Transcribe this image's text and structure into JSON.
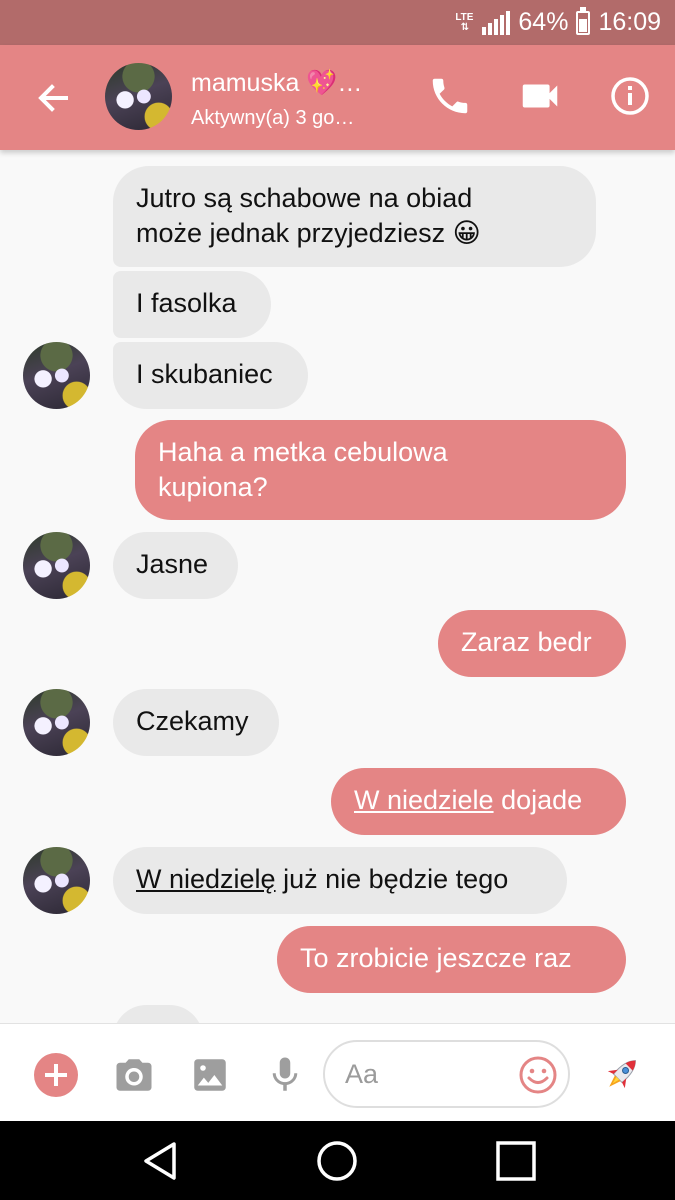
{
  "status_bar": {
    "network": "LTE",
    "battery_percent": "64%",
    "battery_level": 0.64,
    "time": "16:09"
  },
  "header": {
    "contact_name": "mamuska 💖…",
    "contact_status": "Aktywny(a) 3 go…",
    "icons": [
      "back-arrow-icon",
      "phone-icon",
      "video-camera-icon",
      "info-icon"
    ]
  },
  "messages": [
    {
      "direction": "in",
      "lines": [
        "Jutro są schabowe na obiad",
        "może jednak przyjedziesz 😀"
      ]
    },
    {
      "direction": "in",
      "text": "I fasolka"
    },
    {
      "direction": "in",
      "text": "I skubaniec"
    },
    {
      "direction": "out",
      "lines": [
        "Haha a metka cebulowa",
        "kupiona?"
      ]
    },
    {
      "direction": "in",
      "text": "Jasne"
    },
    {
      "direction": "out",
      "text": "Zaraz bedr"
    },
    {
      "direction": "in",
      "text": "Czekamy"
    },
    {
      "direction": "out",
      "underlined": "W niedziele",
      "rest": " dojade"
    },
    {
      "direction": "in",
      "underlined": "W niedzielę",
      "rest": " już nie będzie tego"
    },
    {
      "direction": "out",
      "text": "To zrobicie jeszcze raz"
    }
  ],
  "composer": {
    "placeholder": "Aa",
    "icons": [
      "plus-icon",
      "camera-icon",
      "gallery-icon",
      "microphone-icon",
      "emoji-icon",
      "rocket-icon"
    ]
  },
  "colors": {
    "accent": "#e48585",
    "status_bar": "#b26b6a",
    "incoming_bubble": "#e9e9e9",
    "background": "#f9f9f9"
  }
}
